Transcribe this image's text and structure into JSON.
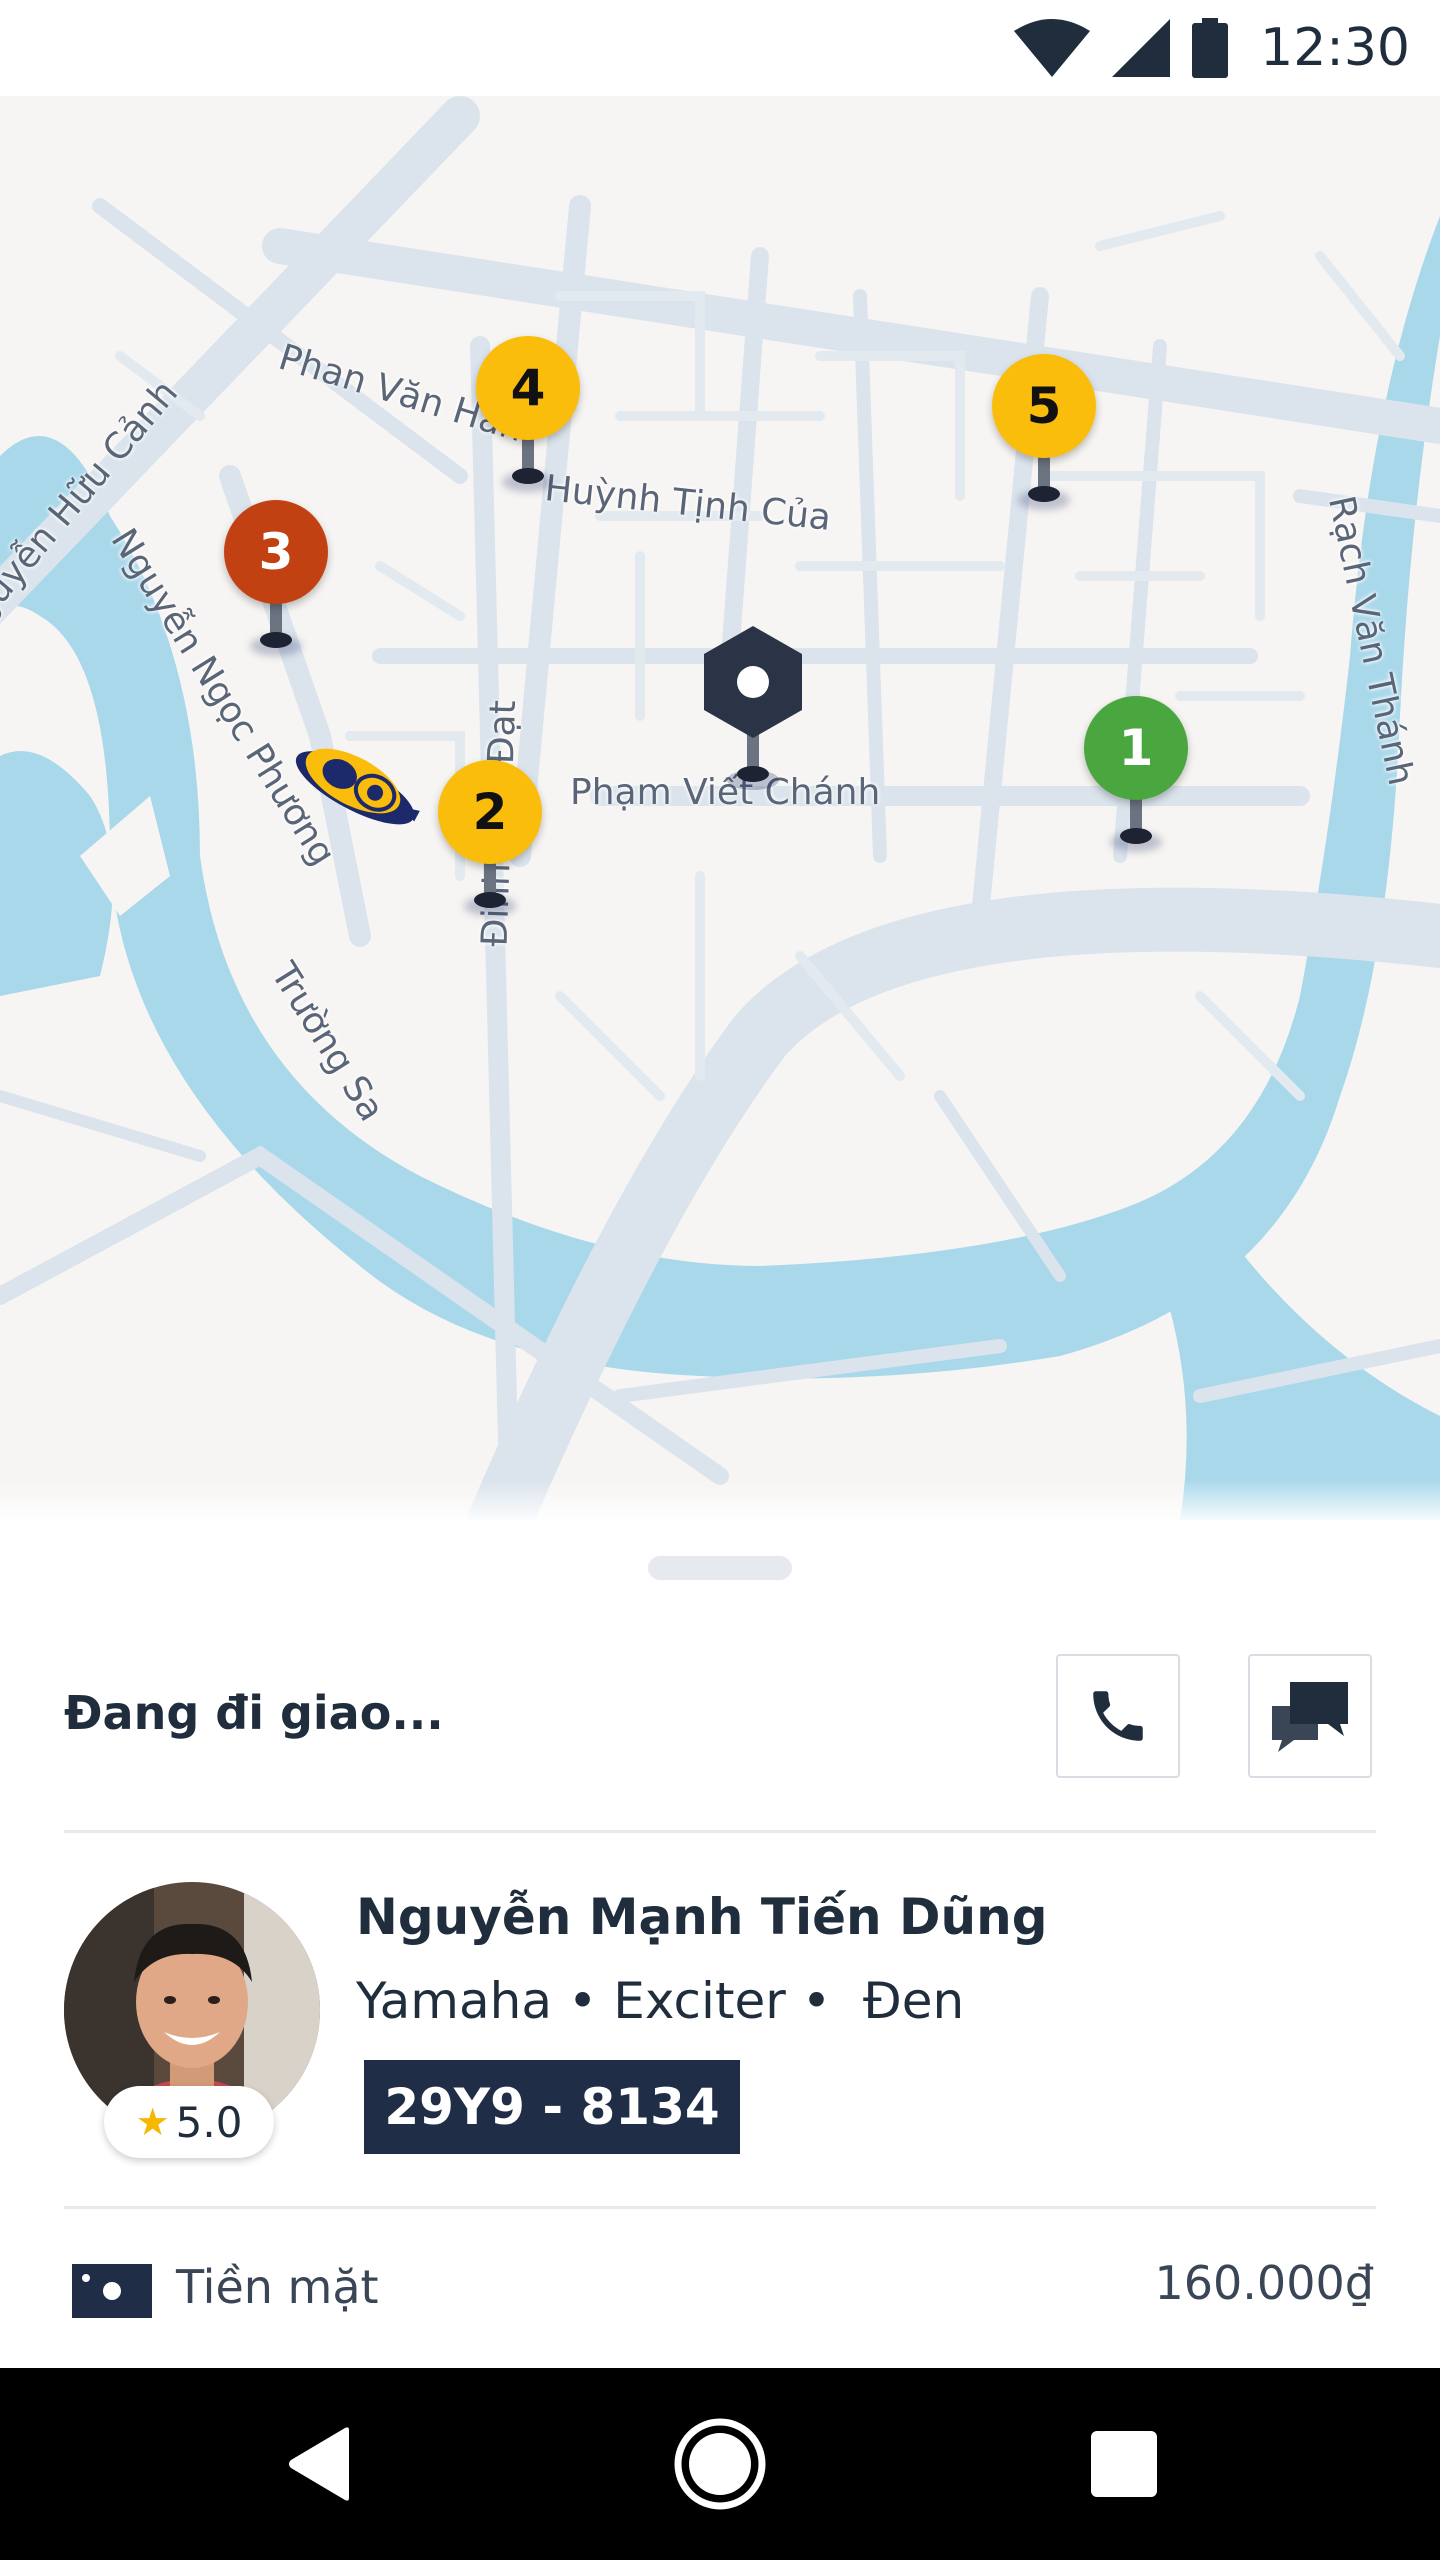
{
  "status_bar": {
    "time": "12:30",
    "icons": [
      "wifi-icon",
      "signal-icon",
      "battery-icon"
    ]
  },
  "map": {
    "streets": [
      "Phan Văn Hân",
      "Huỳnh Tịnh Của",
      "Phạm Viết Chánh",
      "Nguyễn Ngọc Phương",
      "Trường Sa",
      "Đinh Mẫn Đạt",
      "Nguyễn Hữu Cảnh",
      "Rạch Văn Thánh"
    ],
    "stops": [
      {
        "label": "1",
        "color": "#4aa63f",
        "text_color": "#ffffff"
      },
      {
        "label": "2",
        "color": "#fbbd0c",
        "text_color": "#111111"
      },
      {
        "label": "3",
        "color": "#c14113",
        "text_color": "#ffffff"
      },
      {
        "label": "4",
        "color": "#fbbd0c",
        "text_color": "#111111"
      },
      {
        "label": "5",
        "color": "#fbbd0c",
        "text_color": "#111111"
      }
    ],
    "water_color": "#aad8eb",
    "road_color": "#dbe4ec"
  },
  "trip": {
    "status": "Đang đi giao...",
    "actions": {
      "call_icon": "phone-icon",
      "chat_icon": "chat-icon"
    }
  },
  "driver": {
    "name": "Nguyễn Mạnh Tiến Dũng",
    "vehicle": "Yamaha • Exciter •  Đen",
    "rating": "5.0",
    "plate": "29Y9 - 8134"
  },
  "payment": {
    "method": "Tiền mặt",
    "amount": "160.000₫"
  },
  "nav": {
    "icons": [
      "back-icon",
      "home-icon",
      "recents-icon"
    ]
  }
}
